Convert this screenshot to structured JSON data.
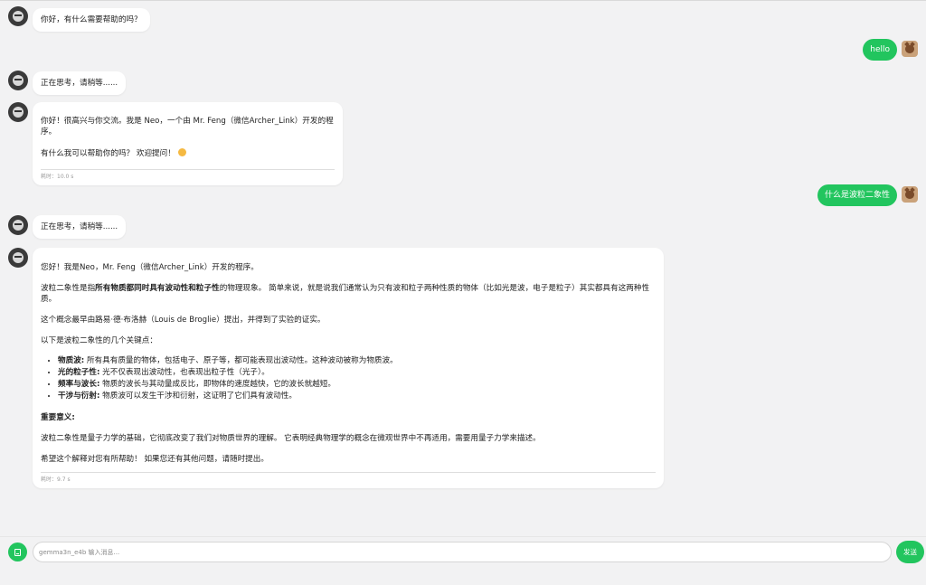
{
  "messages": {
    "m1_bot": {
      "text": "你好，有什么需要帮助的吗？"
    },
    "m2_user": {
      "text": "hello"
    },
    "m3_bot": {
      "text": "正在思考，请稍等......"
    },
    "m4_bot": {
      "line1": "你好！很高兴与你交流。我是 Neo，一个由 Mr. Feng（微信Archer_Link）开发的程序。",
      "line2": "有什么我可以帮助你的吗？ 欢迎提问！",
      "elapsed": "耗时：10.0 s"
    },
    "m5_user": {
      "text": "什么是波粒二象性"
    },
    "m6_bot": {
      "text": "正在思考，请稍等......"
    },
    "m7_bot": {
      "intro": "您好！我是Neo，Mr. Feng（微信Archer_Link）开发的程序。",
      "definition": {
        "pre": "波粒二象性是指",
        "bold": "所有物质都同时具有波动性和粒子性",
        "post": "的物理现象。 简单来说，就是说我们通常认为只有波和粒子两种性质的物体（比如光是波，电子是粒子）其实都具有这两种性质。"
      },
      "origin": "这个概念最早由路易·德·布洛赫（Louis de Broglie）提出，并得到了实验的证实。",
      "points_intro": "以下是波粒二象性的几个关键点：",
      "points": [
        {
          "term": "物质波:",
          "desc": " 所有具有质量的物体，包括电子、原子等，都可能表现出波动性。这种波动被称为物质波。"
        },
        {
          "term": "光的粒子性:",
          "desc": " 光不仅表现出波动性，也表现出粒子性（光子）。"
        },
        {
          "term": "频率与波长:",
          "desc": " 物质的波长与其动量成反比，即物体的速度越快，它的波长就越短。"
        },
        {
          "term": "干涉与衍射:",
          "desc": " 物质波可以发生干涉和衍射，这证明了它们具有波动性。"
        }
      ],
      "significance_heading": "重要意义:",
      "significance": "波粒二象性是量子力学的基础，它彻底改变了我们对物质世界的理解。 它表明经典物理学的概念在微观世界中不再适用，需要用量子力学来描述。",
      "closing": "希望这个解释对您有所帮助！ 如果您还有其他问题，请随时提出。",
      "elapsed": "耗时：9.7 s"
    }
  },
  "composer": {
    "placeholder": "gemma3n_e4b 输入消息...",
    "value": "",
    "send_label": "发送"
  },
  "colors": {
    "accent": "#22c55e",
    "background": "#f2f2f3",
    "bubble_bot": "#ffffff"
  },
  "icons": {
    "bot_avatar": "robot-avatar-icon",
    "user_avatar": "cat-avatar-icon",
    "attach": "document-icon",
    "emoji": "smile-emoji-icon"
  }
}
